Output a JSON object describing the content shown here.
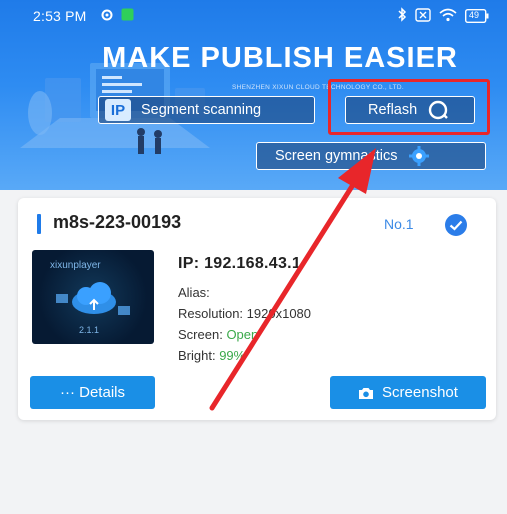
{
  "status_bar": {
    "time": "2:53 PM",
    "icons": [
      "settings-icon",
      "app-notification-icon",
      "bluetooth-icon",
      "x-box-icon",
      "wifi-icon",
      "battery-icon"
    ],
    "battery": "49"
  },
  "banner": {
    "headline": "MAKE PUBLISH EASIER",
    "company": "SHENZHEN XIXUN CLOUD TECHNOLOGY CO., LTD.",
    "segment_scanning": {
      "badge": "IP",
      "label": "Segment scanning"
    },
    "reflash": {
      "label": "Reflash",
      "icon": "refresh-icon"
    },
    "screen_gymnastics": {
      "label": "Screen gymnastics",
      "icon": "gear-icon"
    }
  },
  "device_card": {
    "name": "m8s-223-00193",
    "number": "No.1",
    "selected": true,
    "thumbnail": {
      "app_name": "xixunplayer",
      "version": "2.1.1"
    },
    "ip": "IP: 192.168.43.1",
    "alias": "Alias:",
    "resolution_label": "Resolution:",
    "resolution_value": "1920x1080",
    "screen_label": "Screen:",
    "screen_value": "Open",
    "bright_label": "Bright:",
    "bright_value": "99%",
    "details_button": "··· Details",
    "screenshot_button": "Screenshot"
  },
  "annotation": {
    "highlight_color": "#e8262a",
    "arrow_color": "#e8262a"
  },
  "colors": {
    "accent": "#1a8fe6",
    "banner": "#1f7be9",
    "status_green": "#3aa94a"
  }
}
